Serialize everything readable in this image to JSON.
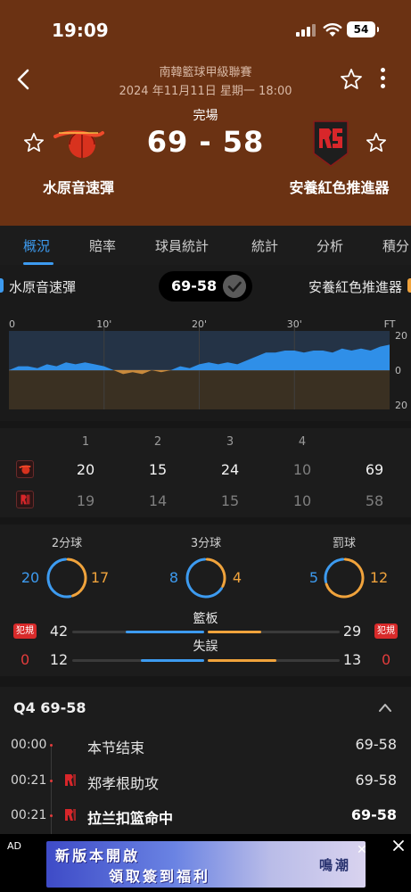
{
  "status_bar": {
    "time": "19:09",
    "battery": "54"
  },
  "header": {
    "league": "南韓籃球甲級聯賽",
    "datetime": "2024 年11月11日 星期一 18:00",
    "status": "完場",
    "score": "69 - 58",
    "home_team": "水原音速彈",
    "away_team": "安養紅色推進器"
  },
  "tabs": [
    "概況",
    "賠率",
    "球員統計",
    "統計",
    "分析",
    "積分"
  ],
  "active_tab": "概況",
  "summary": {
    "home": "水原音速彈",
    "score": "69-58",
    "away": "安養紅色推進器"
  },
  "chart_data": {
    "type": "area",
    "x_ticks": [
      "0",
      "10'",
      "20'",
      "30'",
      "FT"
    ],
    "y_ticks": [
      "20",
      "0",
      "20"
    ],
    "x": [
      0,
      1,
      2,
      3,
      4,
      5,
      6,
      7,
      8,
      9,
      10,
      11,
      12,
      13,
      14,
      15,
      16,
      17,
      18,
      19,
      20,
      21,
      22,
      23,
      24,
      25,
      26,
      27,
      28,
      29,
      30,
      31,
      32,
      33,
      34,
      35,
      36,
      37,
      38,
      39,
      40
    ],
    "lead": [
      0,
      2,
      2,
      1,
      3,
      2,
      4,
      3,
      4,
      3,
      2,
      0,
      -2,
      -1,
      -2,
      0,
      -1,
      0,
      2,
      1,
      3,
      4,
      3,
      4,
      3,
      5,
      7,
      9,
      9,
      10,
      10,
      9,
      10,
      10,
      9,
      11,
      10,
      11,
      10,
      12,
      13
    ],
    "ylim": [
      -20,
      20
    ],
    "positive_color": "#2f8fe8",
    "negative_color": "#c98a3c"
  },
  "quarters": {
    "headers": [
      "1",
      "2",
      "3",
      "4"
    ],
    "home": [
      "20",
      "15",
      "24",
      "10",
      "69"
    ],
    "away": [
      "19",
      "14",
      "15",
      "10",
      "58"
    ]
  },
  "team_stats": {
    "rings": [
      {
        "label": "2分球",
        "home": "20",
        "away": "17",
        "home_value": 20,
        "away_value": 17
      },
      {
        "label": "3分球",
        "home": "8",
        "away": "4",
        "home_value": 8,
        "away_value": 4
      },
      {
        "label": "罰球",
        "home": "5",
        "away": "12",
        "home_value": 5,
        "away_value": 12
      }
    ],
    "foul_label": "犯規",
    "home_fouls": "0",
    "away_fouls": "0",
    "bars": [
      {
        "label": "籃板",
        "home": "42",
        "away": "29",
        "home_value": 42,
        "away_value": 29
      },
      {
        "label": "失誤",
        "home": "12",
        "away": "13",
        "home_value": 12,
        "away_value": 13
      }
    ]
  },
  "play_by_play": {
    "title": "Q4  69-58",
    "events": [
      {
        "time": "00:00",
        "text": "本节结束",
        "score": "69-58",
        "has_logo": false,
        "bold": false
      },
      {
        "time": "00:21",
        "text": "郑孝根助攻",
        "score": "69-58",
        "has_logo": true,
        "bold": false
      },
      {
        "time": "00:21",
        "text": "拉兰扣篮命中",
        "score": "69-58",
        "has_logo": true,
        "bold": true
      }
    ]
  },
  "ad": {
    "tag": "AD",
    "line1": "新版本開啟",
    "line2": "領取簽到福利",
    "brand": "鳴潮"
  },
  "colors": {
    "header_bg": "#6b3213",
    "accent_blue": "#3d9bf0",
    "accent_orange": "#f0a33c",
    "foul_red": "#d82a2a"
  }
}
